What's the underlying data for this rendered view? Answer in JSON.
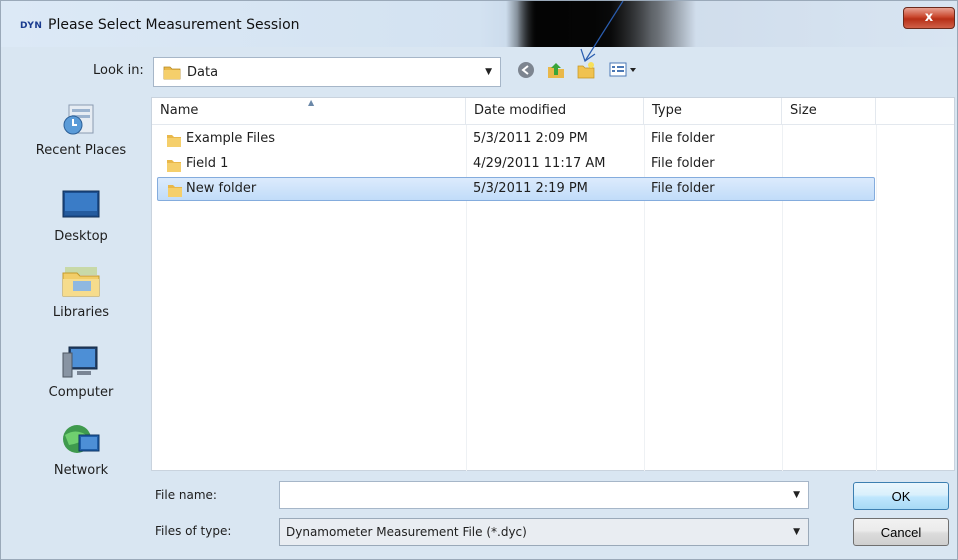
{
  "window": {
    "logo_text": "DYN",
    "title": "Please Select Measurement Session",
    "close_label": "x"
  },
  "lookin": {
    "label": "Look in:",
    "value": "Data"
  },
  "toolbar": {
    "icons": [
      "back-icon",
      "up-folder-icon",
      "new-folder-icon",
      "view-menu-icon"
    ]
  },
  "places": [
    {
      "label": "Recent Places",
      "icon": "recent-places-icon"
    },
    {
      "label": "Desktop",
      "icon": "desktop-icon"
    },
    {
      "label": "Libraries",
      "icon": "libraries-icon"
    },
    {
      "label": "Computer",
      "icon": "computer-icon"
    },
    {
      "label": "Network",
      "icon": "network-icon"
    }
  ],
  "columns": [
    "Name",
    "Date modified",
    "Type",
    "Size"
  ],
  "files": [
    {
      "name": "Example Files",
      "date": "5/3/2011 2:09 PM",
      "type": "File folder",
      "size": ""
    },
    {
      "name": "Field 1",
      "date": "4/29/2011 11:17 AM",
      "type": "File folder",
      "size": ""
    },
    {
      "name": "New folder",
      "date": "5/3/2011 2:19 PM",
      "type": "File folder",
      "size": "",
      "selected": true
    }
  ],
  "bottom": {
    "filename_label": "File name:",
    "filename_value": "",
    "filetype_label": "Files of type:",
    "filetype_value": "Dynamometer Measurement File (*.dyc)",
    "ok_label": "OK",
    "cancel_label": "Cancel"
  },
  "colors": {
    "dialog_bg": "#d9e6f2",
    "selection": "#c1dcf9",
    "close_red": "#c9462c",
    "annotation_arrow": "#2a5db0"
  }
}
